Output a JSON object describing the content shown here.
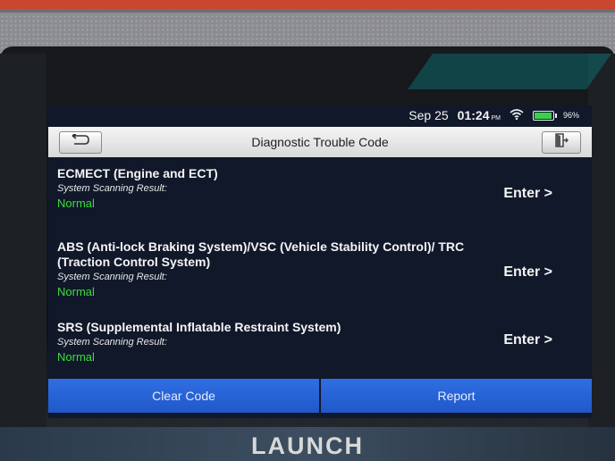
{
  "status": {
    "date": "Sep 25",
    "time": "01:24",
    "ampm": "PM",
    "battery": "96%"
  },
  "header": {
    "title": "Diagnostic Trouble Code"
  },
  "systems": [
    {
      "name": "ECMECT (Engine and ECT)",
      "result_label": "System Scanning Result:",
      "result": "Normal",
      "action": "Enter >"
    },
    {
      "name": "ABS (Anti-lock Braking System)/VSC (Vehicle Stability Control)/ TRC (Traction Control System)",
      "result_label": "System Scanning Result:",
      "result": "Normal",
      "action": "Enter >"
    },
    {
      "name": "SRS (Supplemental Inflatable Restraint System)",
      "result_label": "System Scanning Result:",
      "result": "Normal",
      "action": "Enter >"
    }
  ],
  "footer": {
    "clear_label": "Clear Code",
    "report_label": "Report"
  },
  "device": {
    "brand": "LAUNCH"
  },
  "colors": {
    "accent": "#2f6ee3",
    "normal": "#3ddc3d"
  }
}
